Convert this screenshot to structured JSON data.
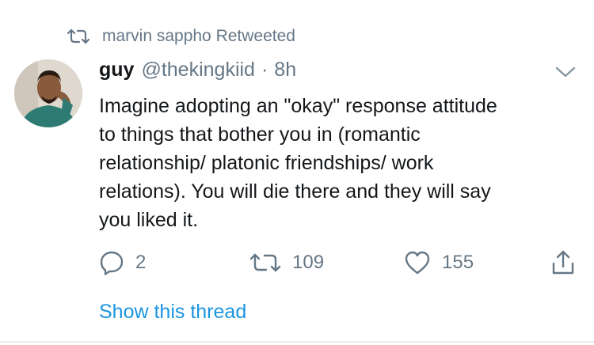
{
  "retweet_context": {
    "icon": "retweet-icon",
    "text": "marvin sappho Retweeted"
  },
  "tweet": {
    "author_name": "guy",
    "author_handle": "@thekingkiid",
    "separator": "·",
    "time": "8h",
    "text": "Imagine adopting an \"okay\" response attitude\nto things that bother you in (romantic\nrelationship/ platonic friendships/ work\nrelations). You will die there and they will say\nyou liked it.",
    "menu_icon": "chevron-down-icon"
  },
  "actions": {
    "reply": {
      "icon": "reply-icon",
      "count": "2"
    },
    "retweet": {
      "icon": "retweet-icon",
      "count": "109"
    },
    "like": {
      "icon": "heart-icon",
      "count": "155"
    },
    "share": {
      "icon": "share-icon"
    }
  },
  "thread_link": "Show this thread",
  "colors": {
    "text_primary": "#14171a",
    "text_secondary": "#657786",
    "link": "#1b95e0",
    "divider": "#e6ecf0"
  }
}
